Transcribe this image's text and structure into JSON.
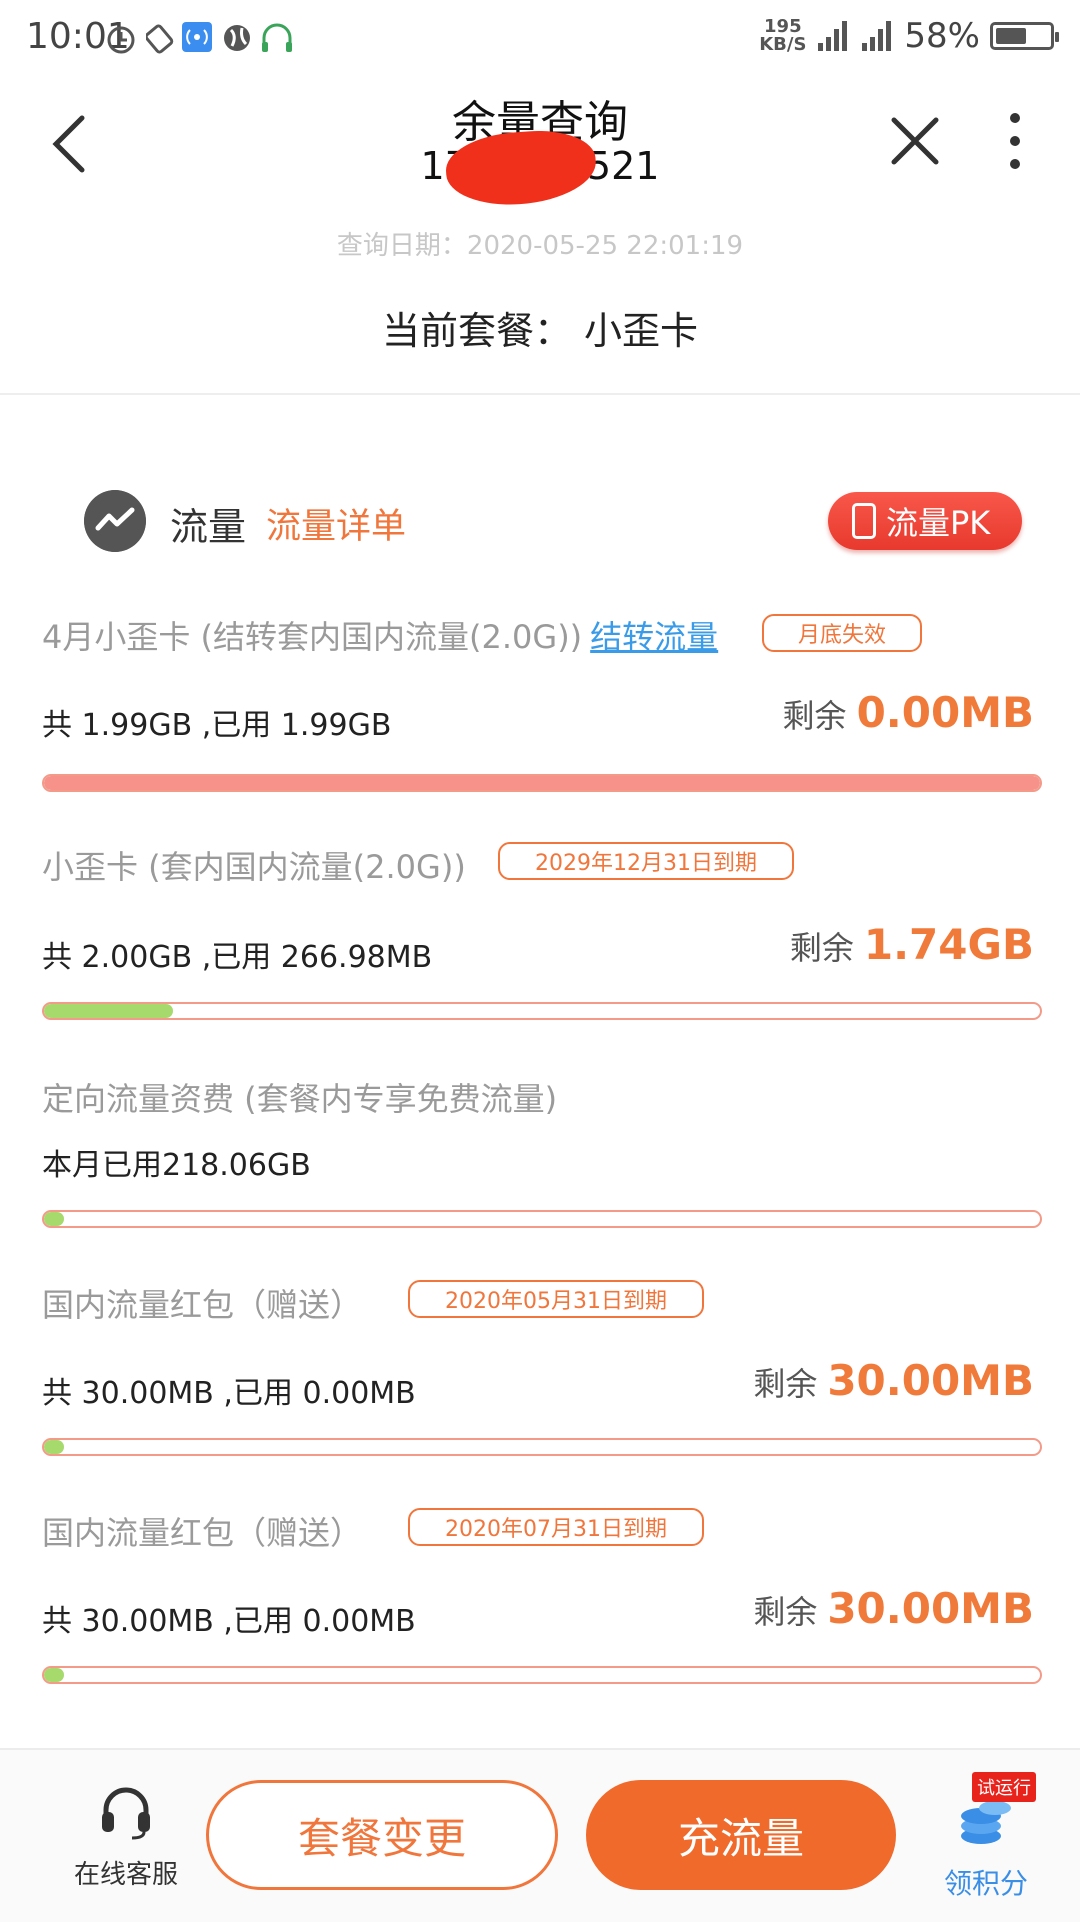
{
  "status_bar": {
    "time": "10:01",
    "net_speed_value": "195",
    "net_speed_unit": "KB/S",
    "battery": "58%",
    "battery_level": 0.58
  },
  "header": {
    "title": "余量查询",
    "phone_prefix": "17",
    "phone_suffix": "521"
  },
  "query_date": "查询日期：2020-05-25 22:01:19",
  "current_plan": "当前套餐：  小歪卡",
  "section": {
    "label": "流量",
    "detail_link": "流量详单",
    "pk_button": "流量PK"
  },
  "items": [
    {
      "title": "4月小歪卡 (结转套内国内流量(2.0G))",
      "link": "结转流量",
      "tag": "月底失效",
      "usage": "共 1.99GB ,已用 1.99GB",
      "remain_label": "剩余",
      "remain_value": "0.00MB",
      "used_fraction": 1.0,
      "bar_color": "#f6928a"
    },
    {
      "title": "小歪卡 (套内国内流量(2.0G))",
      "tag": "2029年12月31日到期",
      "usage": "共 2.00GB ,已用 266.98MB",
      "remain_label": "剩余",
      "remain_value": "1.74GB",
      "used_fraction": 0.13,
      "bar_color": "#a6da6c"
    },
    {
      "title": "定向流量资费 (套餐内专享免费流量)",
      "usage": "本月已用218.06GB",
      "used_fraction": 0.02,
      "bar_color": "#a6da6c"
    },
    {
      "title": "国内流量红包（赠送）",
      "tag": "2020年05月31日到期",
      "usage": "共 30.00MB ,已用 0.00MB",
      "remain_label": "剩余",
      "remain_value": "30.00MB",
      "used_fraction": 0.02,
      "bar_color": "#a6da6c"
    },
    {
      "title": "国内流量红包（赠送）",
      "tag": "2020年07月31日到期",
      "usage": "共 30.00MB ,已用 0.00MB",
      "remain_label": "剩余",
      "remain_value": "30.00MB",
      "used_fraction": 0.02,
      "bar_color": "#a6da6c"
    }
  ],
  "bottom_bar": {
    "service_label": "在线客服",
    "change_plan": "套餐变更",
    "recharge": "充流量",
    "points_label": "领积分",
    "points_badge": "试运行"
  },
  "colors": {
    "accent": "#f0763c",
    "link": "#3a9be8",
    "danger": "#e8392e"
  }
}
